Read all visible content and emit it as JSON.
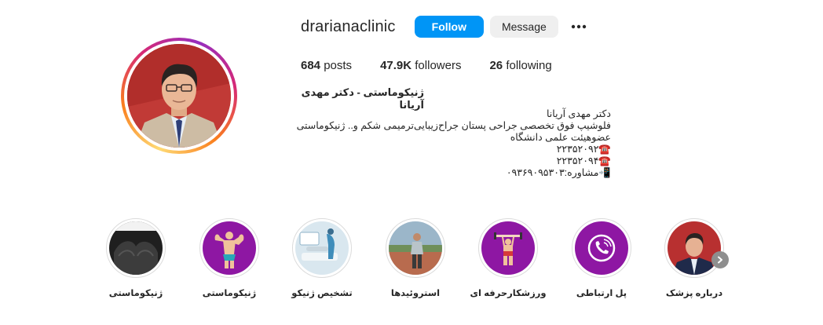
{
  "profile": {
    "username": "drarianaclinic",
    "follow_label": "Follow",
    "message_label": "Message",
    "more_icon": "more-horizontal-icon",
    "full_name": "ژنیکوماستی - دکتر مهدی آریانا"
  },
  "stats": {
    "posts_count": "684",
    "posts_label": "posts",
    "followers_count": "47.9K",
    "followers_label": "followers",
    "following_count": "26",
    "following_label": "following"
  },
  "bio": {
    "lines": [
      "دکتر مهدی آریانا",
      "فلوشیپ فوق تخصصی جراحی پستان جراح‌زیبایی‌ترمیمی شکم و.. ژنیکوماستی",
      "عضوهیئت علمی دانشگاه",
      "☎️۲۲۳۵۲۰۹۲",
      "☎️۲۲۳۵۲۰۹۴",
      "📲مشاوره:۰۹۳۶۹۰۹۵۳۰۳"
    ]
  },
  "highlights": [
    {
      "label": "درباره پزشک",
      "icon": "doctor-photo"
    },
    {
      "label": "پل ارتباطی",
      "icon": "phone-call-icon"
    },
    {
      "label": "ورزشکارحرفه ای",
      "icon": "athlete-icon"
    },
    {
      "label": "استروئیدها",
      "icon": "runner-photo"
    },
    {
      "label": "تشخیص ژنیکو",
      "icon": "ultrasound-photo"
    },
    {
      "label": "ژنیکوماستی",
      "icon": "muscle-man-icon"
    },
    {
      "label": "ژنیکوماستی",
      "icon": "chest-photo"
    }
  ],
  "colors": {
    "follow_bg": "#0095f6",
    "message_bg": "#efefef",
    "highlight_purple": "#8e17a3",
    "scroll_arrow_bg": "#8e8e8e"
  }
}
